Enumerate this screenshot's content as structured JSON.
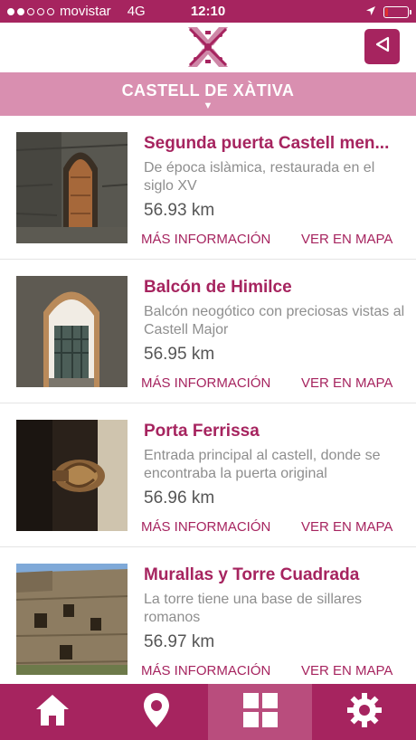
{
  "status_bar": {
    "carrier": "movistar",
    "network": "4G",
    "time": "12:10",
    "battery_level": 0.12
  },
  "header": {
    "logo_icon": "xativa-x-logo-icon",
    "back_icon": "back-arrow-icon"
  },
  "section": {
    "title": "CASTELL DE XÀTIVA",
    "caret": "▼"
  },
  "colors": {
    "brand": "#a6245f",
    "section_bar": "#d98fb0",
    "nav_active": "#b94d7d"
  },
  "items": [
    {
      "title": "Segunda puerta Castell men...",
      "description": "De época islàmica, restaurada en el siglo XV",
      "distance": "56.93 km",
      "more_info": "MÁS INFORMACIÓN",
      "view_map": "VER EN MAPA"
    },
    {
      "title": "Balcón de Himilce",
      "description": "Balcón neogótico con preciosas vistas al Castell Major",
      "distance": "56.95 km",
      "more_info": "MÁS INFORMACIÓN",
      "view_map": "VER EN MAPA"
    },
    {
      "title": "Porta Ferrissa",
      "description": "Entrada principal al castell, donde se encontraba la puerta original",
      "distance": "56.96 km",
      "more_info": "MÁS INFORMACIÓN",
      "view_map": "VER EN MAPA"
    },
    {
      "title": "Murallas y Torre Cuadrada",
      "description": "La torre tiene una base de sillares romanos",
      "distance": "56.97 km",
      "more_info": "MÁS INFORMACIÓN",
      "view_map": "VER EN MAPA"
    }
  ],
  "bottom_nav": [
    {
      "icon": "home-icon"
    },
    {
      "icon": "map-pin-icon"
    },
    {
      "icon": "grid-icon",
      "active": true
    },
    {
      "icon": "gear-icon"
    }
  ]
}
